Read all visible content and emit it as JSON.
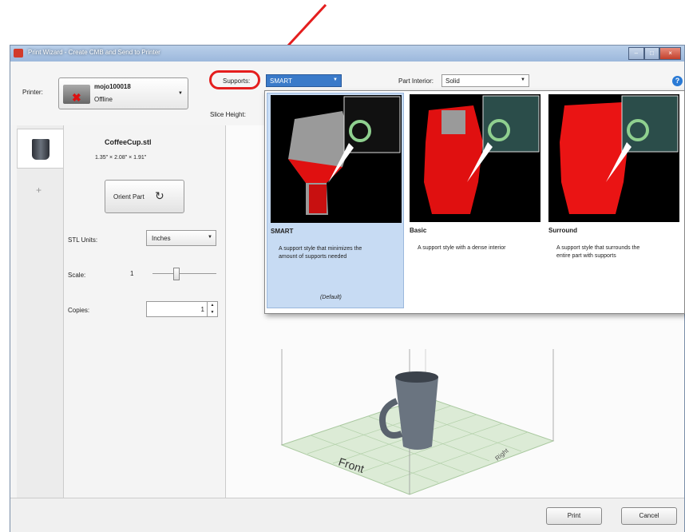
{
  "window": {
    "title": "Print Wizard - Create CMB and Send to Printer",
    "controls": [
      "–",
      "□",
      "×"
    ]
  },
  "printer": {
    "label": "Printer:",
    "name": "mojo100018",
    "status": "Offline",
    "icon": "printer-offline-icon"
  },
  "supports": {
    "label": "Supports:",
    "value": "SMART"
  },
  "part_interior": {
    "label": "Part Interior:",
    "value": "Solid"
  },
  "slice_height": {
    "label": "Slice Height:"
  },
  "help": {
    "glyph": "?",
    "icon": "help-icon"
  },
  "part": {
    "name": "CoffeeCup.stl",
    "dimensions": "1.35\" × 2.08\" × 1.91\"",
    "orient_label": "Orient Part",
    "add_tab": "+"
  },
  "stl_units": {
    "label": "STL Units:",
    "value": "Inches"
  },
  "scale": {
    "label": "Scale:",
    "value": "1"
  },
  "copies": {
    "label": "Copies:",
    "value": "1"
  },
  "support_options": [
    {
      "name": "SMART",
      "description": "A support style that minimizes the amount of supports needed",
      "note": "(Default)"
    },
    {
      "name": "Basic",
      "description": "A support style with a dense interior"
    },
    {
      "name": "Surround",
      "description": "A support style that surrounds the entire part with supports"
    }
  ],
  "viewport": {
    "front_label": "Front",
    "right_label": "Right"
  },
  "buttons": {
    "print": "Print",
    "cancel": "Cancel"
  },
  "colors": {
    "annotation": "#e41e1e",
    "selection_blue": "#3a7ac9",
    "support_red": "#e01010",
    "plate_green": "#dcebd6"
  }
}
